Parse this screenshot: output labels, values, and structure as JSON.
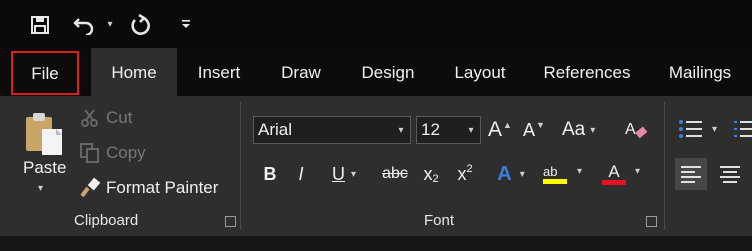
{
  "quick_access": {
    "save_icon": "save-icon",
    "undo_icon": "undo-icon",
    "undo_dropdown_icon": "chevron-down-icon",
    "redo_icon": "redo-icon",
    "customize_icon": "customize-qat-icon"
  },
  "tabs": [
    "File",
    "Home",
    "Insert",
    "Draw",
    "Design",
    "Layout",
    "References",
    "Mailings"
  ],
  "active_tab": "Home",
  "highlight_color": "#e01c1c",
  "clipboard": {
    "paste_label": "Paste",
    "cut_label": "Cut",
    "copy_label": "Copy",
    "format_painter_label": "Format Painter",
    "group_label": "Clipboard"
  },
  "font": {
    "font_name": "Arial",
    "font_size": "12",
    "grow_label": "A",
    "shrink_label": "A",
    "case_label": "Aa",
    "bold_label": "B",
    "italic_label": "I",
    "underline_label": "U",
    "strikethrough_label": "abc",
    "subscript_label": "x",
    "subscript_digit": "2",
    "superscript_label": "x",
    "superscript_digit": "2",
    "text_effects_label": "A",
    "highlight_label": "ab",
    "font_color_label": "A",
    "highlight_bar_color": "#ffff00",
    "font_color_bar_color": "#e81123",
    "text_effects_color": "#3f7fd8",
    "group_label": "Font"
  }
}
